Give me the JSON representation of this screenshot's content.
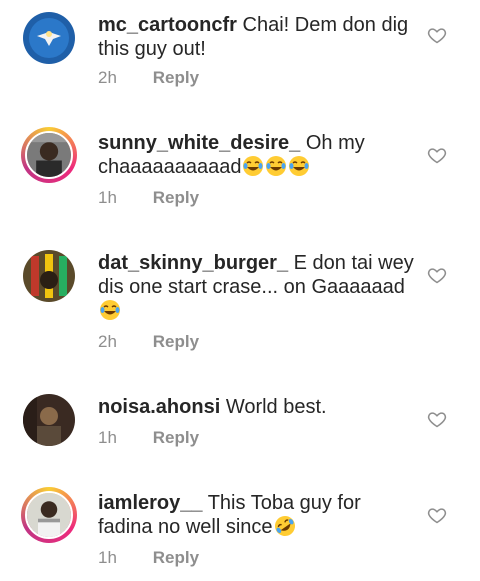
{
  "comments": [
    {
      "username": "mc_cartooncfr",
      "text": "Chai! Dem don dig this guy out!",
      "time": "2h",
      "reply": "Reply",
      "emojis": []
    },
    {
      "username": "sunny_white_desire_",
      "text": "Oh my chaaaaaaaaaad",
      "time": "1h",
      "reply": "Reply",
      "emojis": [
        "tears-of-joy",
        "tears-of-joy",
        "tears-of-joy"
      ]
    },
    {
      "username": "dat_skinny_burger_",
      "text": "E don tai wey dis one start crase... on Gaaaaaad",
      "time": "2h",
      "reply": "Reply",
      "emojis": [
        "tears-of-joy"
      ]
    },
    {
      "username": "noisa.ahonsi",
      "text": "World best.",
      "time": "1h",
      "reply": "Reply",
      "emojis": []
    },
    {
      "username": "iamleroy__",
      "text": "This Toba guy for fadina no well since",
      "time": "1h",
      "reply": "Reply",
      "emojis": [
        "rolling-laughing"
      ]
    }
  ],
  "colors": {
    "text": "#262626",
    "meta": "#8e8e8e",
    "ring_start": "#f9ce34",
    "ring_end": "#c13584"
  },
  "icons": {
    "like": "heart-outline-icon"
  }
}
